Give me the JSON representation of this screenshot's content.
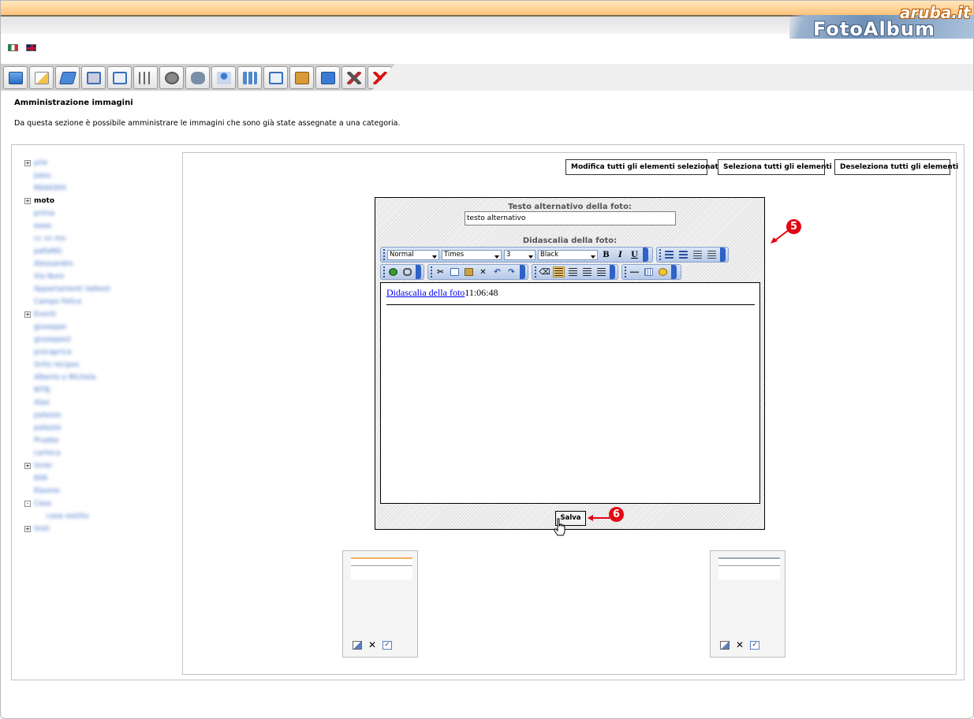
{
  "header": {
    "brand_top": "aruba.it",
    "brand_main": "FotoAlbum"
  },
  "languages": [
    "italian-flag",
    "english-flag"
  ],
  "toolbar": {
    "icons": [
      "album-icon",
      "edit-icon",
      "category-icon",
      "image-add-icon",
      "image-edit-icon",
      "order-icon",
      "upload-icon",
      "camera-icon",
      "users-icon",
      "thumbnails-icon",
      "slideshow-icon",
      "package-icon",
      "help-icon",
      "tools-icon",
      "logout-icon"
    ]
  },
  "page": {
    "title": "Amministrazione immagini",
    "description": "Da questa sezione è possibile amministrare le immagini che sono già state assegnate a una categoria."
  },
  "tree": [
    {
      "label": "prle",
      "expander": "+",
      "level": 0,
      "blurred": true
    },
    {
      "label": "pasu",
      "expander": "",
      "level": 1,
      "blurred": true
    },
    {
      "label": "R64430X",
      "expander": "",
      "level": 1,
      "blurred": true
    },
    {
      "label": "moto",
      "expander": "+",
      "level": 0,
      "blurred": false,
      "bold": true
    },
    {
      "label": "prima",
      "expander": "",
      "level": 1,
      "blurred": true
    },
    {
      "label": "eeee",
      "expander": "",
      "level": 1,
      "blurred": true
    },
    {
      "label": "cc vv mx",
      "expander": "",
      "level": 1,
      "blurred": true
    },
    {
      "label": "pallaNG",
      "expander": "",
      "level": 1,
      "blurred": true
    },
    {
      "label": "Alessandro",
      "expander": "",
      "level": 1,
      "blurred": true
    },
    {
      "label": "Via Nuro",
      "expander": "",
      "level": 1,
      "blurred": true
    },
    {
      "label": "Appartamenti Vallesti",
      "expander": "",
      "level": 1,
      "blurred": true
    },
    {
      "label": "Campo Felice",
      "expander": "",
      "level": 1,
      "blurred": true
    },
    {
      "label": "Eventi",
      "expander": "+",
      "level": 0,
      "blurred": true
    },
    {
      "label": "giuseppe",
      "expander": "",
      "level": 1,
      "blurred": true
    },
    {
      "label": "giuseppe2",
      "expander": "",
      "level": 1,
      "blurred": true
    },
    {
      "label": "procaprica",
      "expander": "",
      "level": 1,
      "blurred": true
    },
    {
      "label": "Grito recipes",
      "expander": "",
      "level": 1,
      "blurred": true
    },
    {
      "label": "Alberto e Michela",
      "expander": "",
      "level": 1,
      "blurred": true
    },
    {
      "label": "NT9j",
      "expander": "",
      "level": 1,
      "blurred": true
    },
    {
      "label": "Alao",
      "expander": "",
      "level": 1,
      "blurred": true
    },
    {
      "label": "palazzo",
      "expander": "",
      "level": 1,
      "blurred": true
    },
    {
      "label": "palazzo",
      "expander": "",
      "level": 1,
      "blurred": true
    },
    {
      "label": "Prueba",
      "expander": "",
      "level": 1,
      "blurred": true
    },
    {
      "label": "cartoca",
      "expander": "",
      "level": 1,
      "blurred": true
    },
    {
      "label": "lorier",
      "expander": "+",
      "level": 0,
      "blurred": true
    },
    {
      "label": "606",
      "expander": "",
      "level": 1,
      "blurred": true
    },
    {
      "label": "Elasme",
      "expander": "",
      "level": 1,
      "blurred": true
    },
    {
      "label": "Casa",
      "expander": "-",
      "level": 0,
      "blurred": true
    },
    {
      "label": "casa sostitu",
      "expander": "",
      "level": 2,
      "blurred": true
    },
    {
      "label": "testi",
      "expander": "+",
      "level": 0,
      "blurred": true
    }
  ],
  "actions": {
    "modify_selected": "Modifica tutti gli elementi selezionati",
    "select_all": "Seleziona tutti gli elementi",
    "deselect_all": "Deseleziona tutti gli elementi"
  },
  "editor": {
    "alt_label": "Testo alternativo della foto:",
    "alt_value": "testo alternativo",
    "caption_label": "Didascalia della foto:",
    "format": "Normal",
    "font": "Times",
    "size": "3",
    "color": "Black",
    "caption_link": "Didascalia della foto",
    "caption_time": "11:06:48",
    "save_label": "Salva"
  },
  "annotations": {
    "marker_editor": "5",
    "marker_save": "6",
    "color": "#e30613"
  },
  "colors": {
    "header_orange": "#ffc47a",
    "toolbar_blue": "#b6c9e8",
    "link_blue": "#0000ee"
  }
}
